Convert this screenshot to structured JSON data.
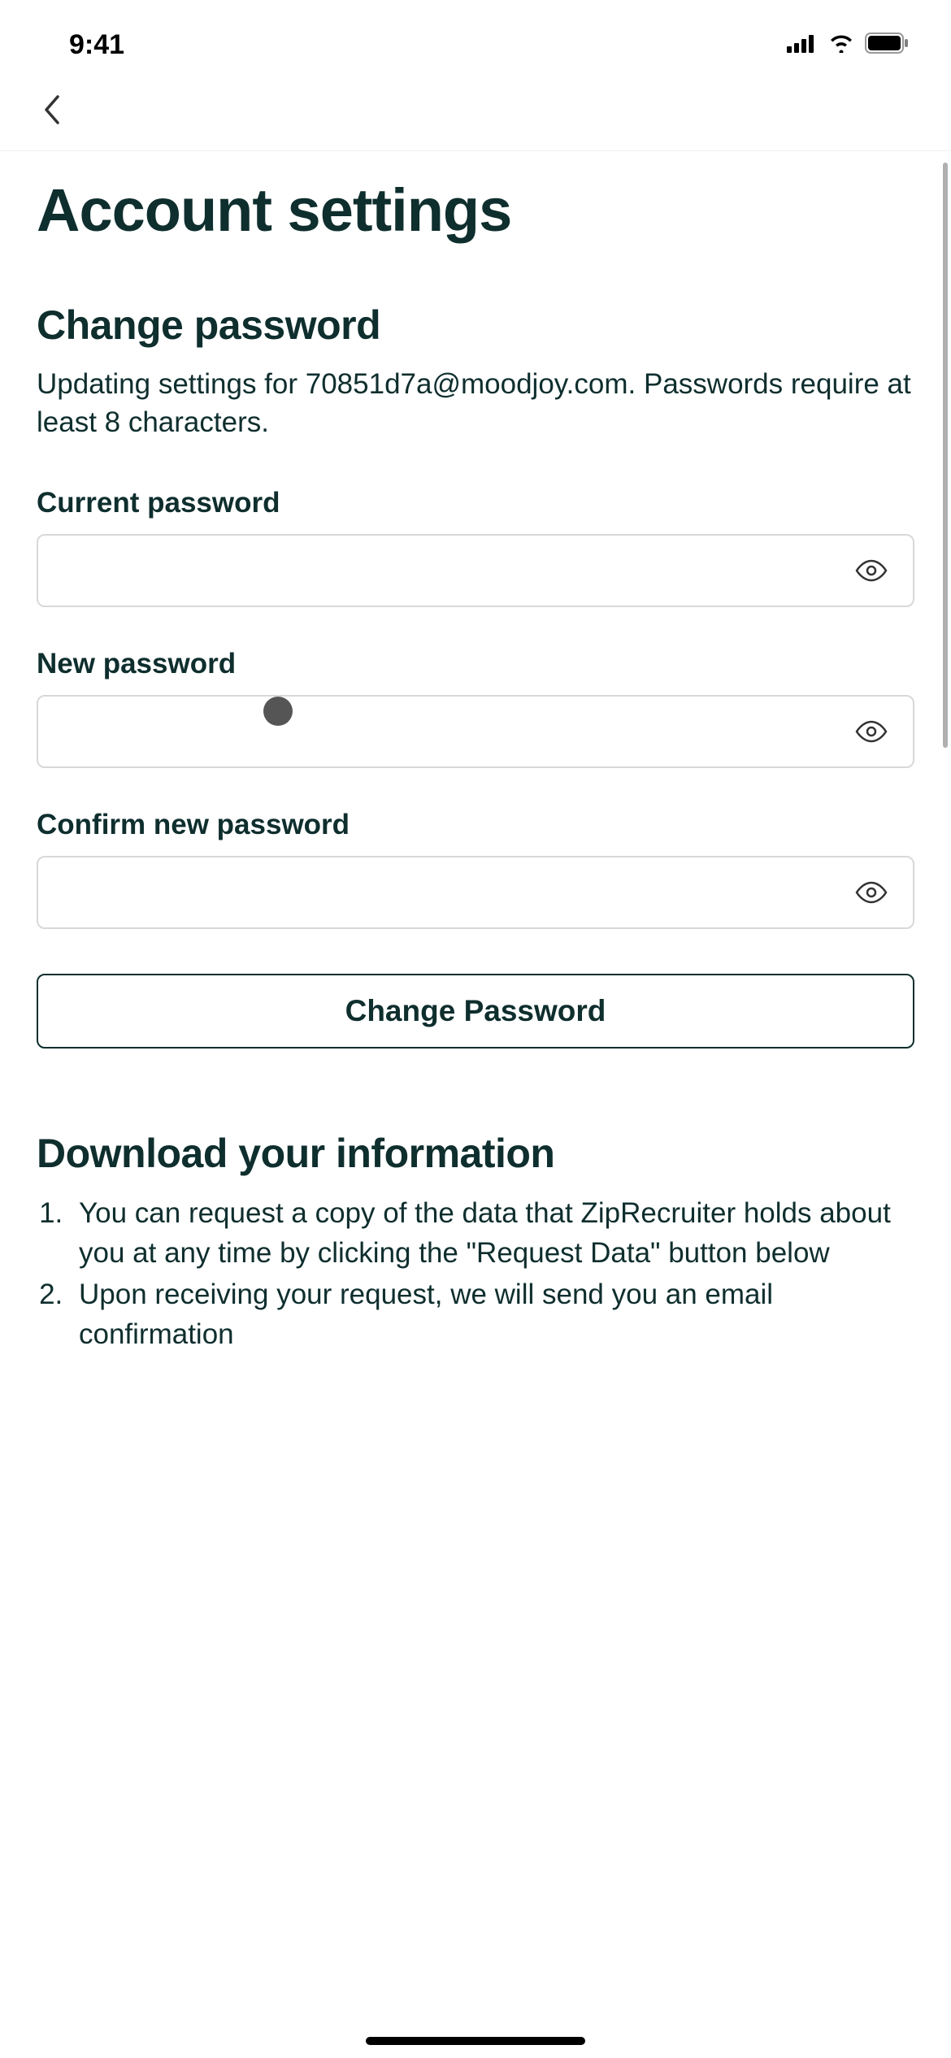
{
  "status": {
    "time": "9:41"
  },
  "page": {
    "title": "Account settings"
  },
  "changePassword": {
    "title": "Change password",
    "description": "Updating settings for 70851d7a@moodjoy.com. Passwords require at least 8 characters.",
    "fields": {
      "current": {
        "label": "Current password",
        "value": ""
      },
      "new": {
        "label": "New password",
        "value": ""
      },
      "confirm": {
        "label": "Confirm new password",
        "value": ""
      }
    },
    "submitLabel": "Change Password"
  },
  "download": {
    "title": "Download your information",
    "items": [
      "You can request a copy of the data that ZipRecruiter holds about you at any time by clicking the \"Request Data\" button below",
      "Upon receiving your request, we will send you an email confirmation"
    ]
  }
}
